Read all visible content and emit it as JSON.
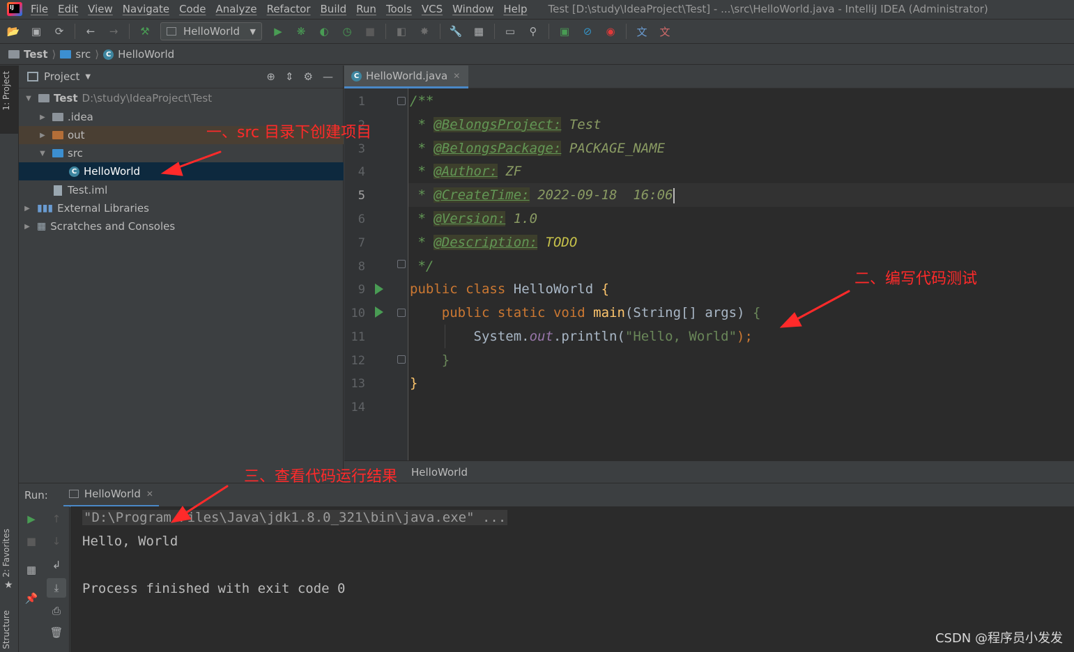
{
  "menubar": {
    "items": [
      "File",
      "Edit",
      "View",
      "Navigate",
      "Code",
      "Analyze",
      "Refactor",
      "Build",
      "Run",
      "Tools",
      "VCS",
      "Window",
      "Help"
    ],
    "title": "Test [D:\\study\\IdeaProject\\Test] - ...\\src\\HelloWorld.java - IntelliJ IDEA (Administrator)"
  },
  "toolbar": {
    "run_config": "HelloWorld"
  },
  "breadcrumb": {
    "items": [
      "Test",
      "src",
      "HelloWorld"
    ]
  },
  "left_stripe": {
    "project_tab": "1: Project",
    "favorites_tab": "2: Favorites",
    "structure_tab": "Structure"
  },
  "project_panel": {
    "title": "Project",
    "tree": [
      {
        "label": "Test",
        "path": "D:\\study\\IdeaProject\\Test"
      },
      {
        "label": ".idea"
      },
      {
        "label": "out"
      },
      {
        "label": "src"
      },
      {
        "label": "HelloWorld"
      },
      {
        "label": "Test.iml"
      },
      {
        "label": "External Libraries"
      },
      {
        "label": "Scratches and Consoles"
      }
    ]
  },
  "editor": {
    "tab_label": "HelloWorld.java",
    "current_line": 5,
    "line_numbers": [
      "1",
      "2",
      "3",
      "4",
      "5",
      "6",
      "7",
      "8",
      "9",
      "10",
      "11",
      "12",
      "13",
      "14"
    ],
    "doc": {
      "open": "/**",
      "star": "*",
      "tag_project": "@BelongsProject:",
      "val_project": "Test",
      "tag_package": "@BelongsPackage:",
      "val_package": "PACKAGE_NAME",
      "tag_author": "@Author:",
      "val_author": "ZF",
      "tag_create": "@CreateTime:",
      "val_create": "2022-09-18  16:06",
      "tag_version": "@Version:",
      "val_version": "1.0",
      "tag_desc": "@Description:",
      "val_desc": "TODO",
      "close": "*/"
    },
    "code": {
      "kw_public": "public",
      "kw_class": "class",
      "class_name": "HelloWorld",
      "open_brace": "{",
      "kw_static": "static",
      "kw_void": "void",
      "method_name": "main",
      "params": "(String[] args)",
      "system": "System.",
      "out": "out",
      "println": ".println(",
      "string": "\"Hello, World\"",
      "end_stmt": ");",
      "close_brace": "}"
    },
    "breadcrumb": "HelloWorld"
  },
  "run_panel": {
    "label": "Run:",
    "tab_label": "HelloWorld",
    "console": [
      "\"D:\\Program Files\\Java\\jdk1.8.0_321\\bin\\java.exe\" ...",
      "Hello, World",
      "",
      "Process finished with exit code 0"
    ]
  },
  "annotations": {
    "step1": "一、src 目录下创建项目",
    "step2": "二、编写代码测试",
    "step3": "三、查看代码运行结果",
    "color": "#ff2a2a"
  },
  "watermark": "CSDN @程序员小发发"
}
